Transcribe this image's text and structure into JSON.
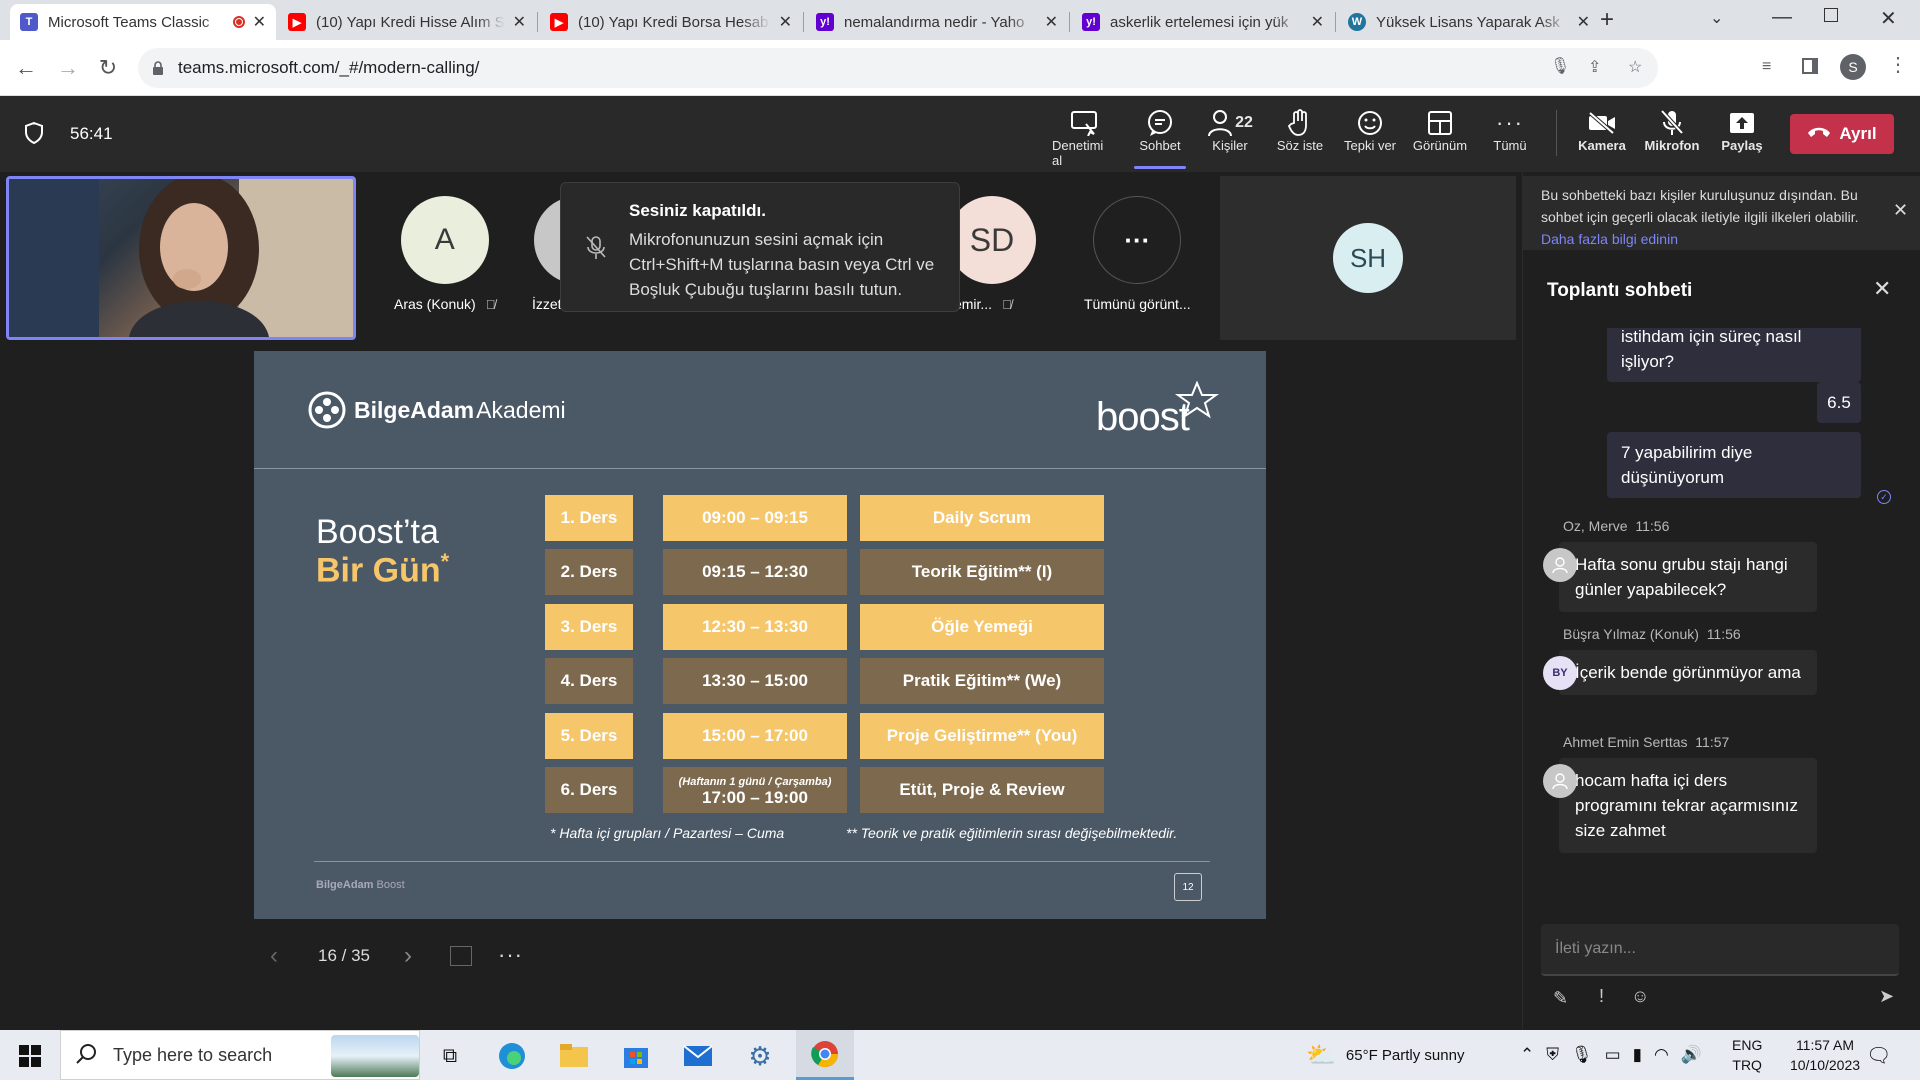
{
  "browser": {
    "tabs": [
      {
        "title": "Microsoft Teams Classic",
        "favicon": "teams-icon",
        "active": true
      },
      {
        "title": "(10) Yapı Kredi Hisse Alım S",
        "favicon": "youtube-icon"
      },
      {
        "title": "(10) Yapı Kredi Borsa Hesab",
        "favicon": "youtube-icon"
      },
      {
        "title": "nemalandırma nedir - Yaho",
        "favicon": "yahoo-icon"
      },
      {
        "title": "askerlik ertelemesi için yük",
        "favicon": "yahoo-icon"
      },
      {
        "title": "Yüksek Lisans Yaparak Ask",
        "favicon": "wordpress-icon"
      }
    ],
    "url": "teams.microsoft.com/_#/modern-calling/",
    "profile_initial": "S"
  },
  "teams": {
    "timer": "56:41",
    "toolbar": [
      {
        "label": "Denetimi al",
        "icon": "take-control-icon"
      },
      {
        "label": "Sohbet",
        "icon": "chat-icon",
        "selected": true
      },
      {
        "label": "Kişiler",
        "icon": "people-icon",
        "count": "22"
      },
      {
        "label": "Söz iste",
        "icon": "raise-hand-icon"
      },
      {
        "label": "Tepki ver",
        "icon": "reaction-icon"
      },
      {
        "label": "Görünüm",
        "icon": "view-icon"
      },
      {
        "label": "Tümü",
        "icon": "more-icon"
      },
      {
        "label": "Kamera",
        "icon": "camera-off-icon"
      },
      {
        "label": "Mikrofon",
        "icon": "mic-off-icon"
      },
      {
        "label": "Paylaş",
        "icon": "share-icon"
      }
    ],
    "leave_label": "Ayrıl",
    "participants": [
      {
        "initials": "A",
        "name": "Aras (Konuk)"
      },
      {
        "initials": "",
        "name": "İzzet A"
      },
      {
        "initials": "SD",
        "name": "n Demir..."
      },
      {
        "initials": "···",
        "name": "Tümünü görünt..."
      }
    ],
    "sh_tile": "SH",
    "toast": {
      "title": "Sesiniz kapatıldı.",
      "body": "Mikrofonunuzun sesini açmak için Ctrl+Shift+M tuşlarına basın veya Ctrl ve Boşluk Çubuğu tuşlarını basılı tutun."
    },
    "slide_controls": {
      "page": "16 / 35"
    }
  },
  "slide": {
    "brand_left": "BilgeAdam",
    "brand_left_b": "Akademi",
    "brand_right": "boost",
    "heading_line1": "Boost’ta",
    "heading_line2": "Bir Gün",
    "heading_star": "*",
    "rows": [
      {
        "ders": "1. Ders",
        "time": "09:00 – 09:15",
        "topic": "Daily Scrum",
        "style": "y"
      },
      {
        "ders": "2. Ders",
        "time": "09:15 – 12:30",
        "topic": "Teorik Eğitim** (I)",
        "style": "b"
      },
      {
        "ders": "3. Ders",
        "time": "12:30 – 13:30",
        "topic": "Öğle Yemeği",
        "style": "y"
      },
      {
        "ders": "4. Ders",
        "time": "13:30 – 15:00",
        "topic": "Pratik Eğitim** (We)",
        "style": "b"
      },
      {
        "ders": "5. Ders",
        "time": "15:00 – 17:00",
        "topic": "Proje Geliştirme** (You)",
        "style": "y"
      },
      {
        "ders": "6. Ders",
        "time_note": "(Haftanın 1 günü / Çarşamba)",
        "time": "17:00 – 19:00",
        "topic": "Etüt, Proje & Review",
        "style": "b"
      }
    ],
    "footnote_left": "* Hafta içi grupları / Pazartesi – Cuma",
    "footnote_right": "** Teorik ve pratik eğitimlerin sırası değişebilmektedir.",
    "footer_brand": "BilgeAdam",
    "footer_brand_b": "Boost",
    "slide_number": "12"
  },
  "chat": {
    "notice": "Bu sohbetteki bazı kişiler kuruluşunuz dışından. Bu sohbet için geçerli olacak iletiyle ilgili ilkeleri olabilir.",
    "notice_link": "Daha fazla bilgi edinin",
    "title": "Toplantı sohbeti",
    "my_messages": [
      "istihdam için süreç nasıl işliyor?",
      "6.5",
      "7 yapabilirim diye düşünüyorum"
    ],
    "messages": [
      {
        "author": "Oz, Merve",
        "time": "11:56",
        "text": "Hafta sonu grubu stajı  hangi günler yapabilecek?",
        "avatar": ""
      },
      {
        "author": "Büşra Yılmaz (Konuk)",
        "time": "11:56",
        "text": "İçerik bende görünmüyor ama",
        "avatar": "BY"
      },
      {
        "author": "Ahmet Emin Serttas",
        "time": "11:57",
        "text": "hocam hafta içi ders programını tekrar açarmısınız size zahmet",
        "avatar": ""
      }
    ],
    "input_placeholder": "İleti yazın..."
  },
  "taskbar": {
    "search_placeholder": "Type here to search",
    "weather": "65°F  Partly sunny",
    "lang1": "ENG",
    "lang2": "TRQ",
    "time": "11:57 AM",
    "date": "10/10/2023"
  },
  "colors": {
    "accent": "#7f85f5",
    "leave": "#c4314b",
    "slide_yellow": "#f6c66a",
    "slide_brown": "#7d6a4e"
  }
}
